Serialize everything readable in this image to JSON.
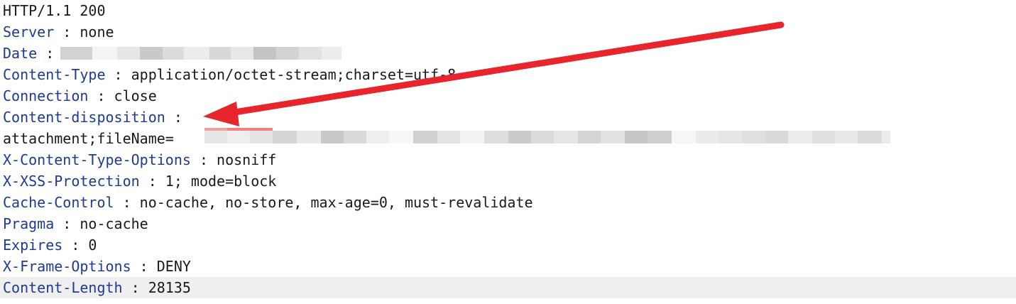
{
  "status_line": "HTTP/1.1 200",
  "headers": [
    {
      "name": "Server",
      "sep": " : ",
      "value": "none"
    },
    {
      "name": "Date",
      "sep": " : ",
      "value": ""
    },
    {
      "name": "Content-Type",
      "sep": " : ",
      "value": "application/octet-stream;charset=utf-8"
    },
    {
      "name": "Connection",
      "sep": " : ",
      "value": "close"
    },
    {
      "name": "Content-disposition",
      "sep": " : ",
      "value": ""
    },
    {
      "name": "",
      "sep": "",
      "value": "attachment;fileName="
    },
    {
      "name": "X-Content-Type-Options",
      "sep": " : ",
      "value": "nosniff"
    },
    {
      "name": "X-XSS-Protection",
      "sep": " : ",
      "value": "1; mode=block"
    },
    {
      "name": "Cache-Control",
      "sep": " : ",
      "value": "no-cache, no-store, max-age=0, must-revalidate"
    },
    {
      "name": "Pragma",
      "sep": " : ",
      "value": "no-cache"
    },
    {
      "name": "Expires",
      "sep": " : ",
      "value": "0"
    },
    {
      "name": "X-Frame-Options",
      "sep": " : ",
      "value": "DENY"
    },
    {
      "name": "Content-Length",
      "sep": " : ",
      "value": "28135"
    }
  ],
  "colors": {
    "header_name": "#1f3a93",
    "arrow": "#e8242c",
    "highlight_row": "#efefef"
  },
  "icons": {
    "annotation": "red-arrow-icon"
  }
}
